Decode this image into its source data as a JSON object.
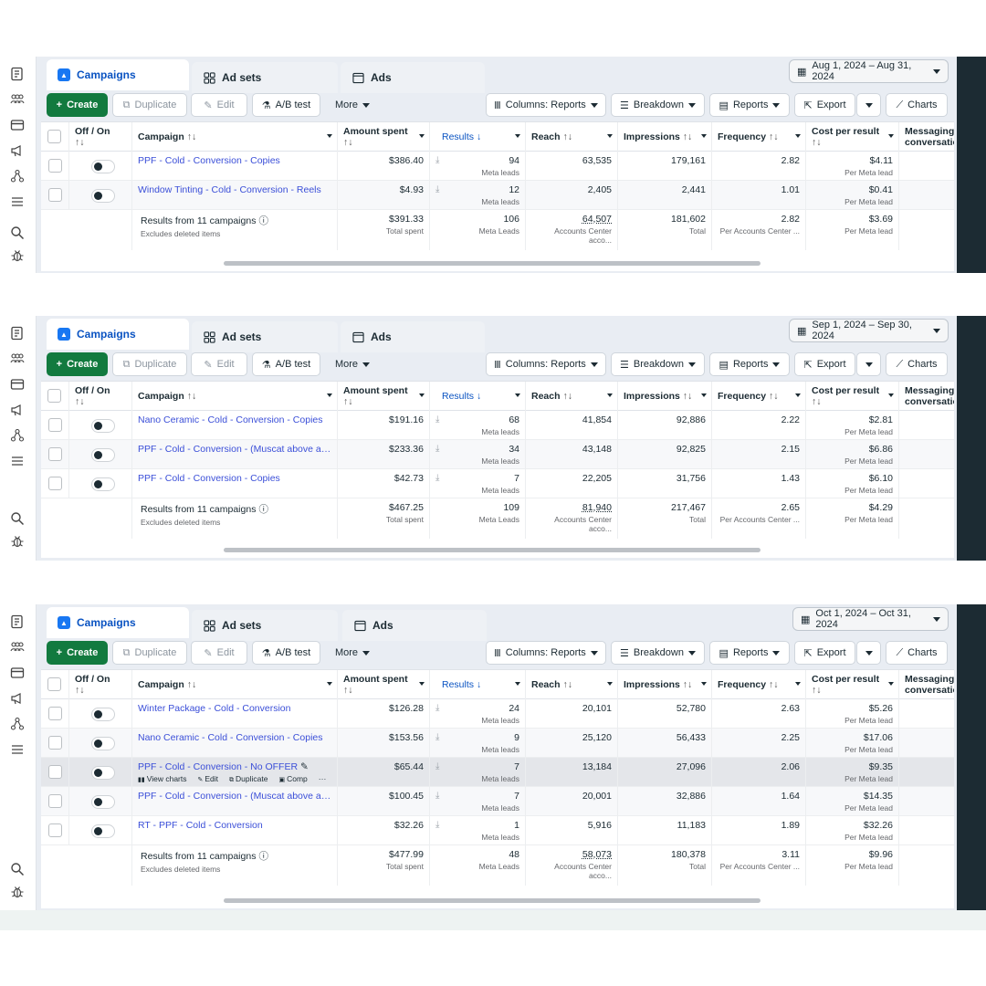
{
  "tabs": {
    "campaigns": "Campaigns",
    "adsets": "Ad sets",
    "ads": "Ads"
  },
  "toolbar": {
    "create": "Create",
    "duplicate": "Duplicate",
    "edit": "Edit",
    "abtest": "A/B test",
    "more": "More",
    "columns": "Columns: Reports",
    "breakdown": "Breakdown",
    "reports": "Reports",
    "export": "Export",
    "charts": "Charts"
  },
  "columns": {
    "offon": "Off / On",
    "campaign": "Campaign",
    "amount": "Amount spent",
    "results": "Results",
    "reach": "Reach",
    "impressions": "Impressions",
    "frequency": "Frequency",
    "cpr": "Cost per result",
    "messaging": "Messaging conversatio",
    "sort_glyph": "↑↓",
    "sort_down": "↓"
  },
  "total_labels": {
    "results_from": "Results from 11 campaigns",
    "excludes": "Excludes deleted items",
    "total_spent": "Total spent",
    "meta_leads_cap": "Meta Leads",
    "accounts_center": "Accounts Center acco...",
    "total": "Total",
    "per_accounts_center": "Per Accounts Center ...",
    "per_meta_lead": "Per Meta lead"
  },
  "sub_labels": {
    "meta_leads": "Meta leads",
    "per_meta_lead": "Per Meta lead"
  },
  "hover_actions": {
    "view_charts": "View charts",
    "edit": "Edit",
    "duplicate": "Duplicate",
    "comp": "Comp",
    "more": "···"
  },
  "panels": [
    {
      "date_range": "Aug 1, 2024 – Aug 31, 2024",
      "rows": [
        {
          "campaign": "PPF - Cold - Conversion - Copies",
          "amount": "$386.40",
          "results": "94",
          "reach": "63,535",
          "impressions": "179,161",
          "frequency": "2.82",
          "cpr": "$4.11"
        },
        {
          "campaign": "Window Tinting - Cold - Conversion - Reels",
          "amount": "$4.93",
          "results": "12",
          "reach": "2,405",
          "impressions": "2,441",
          "frequency": "1.01",
          "cpr": "$0.41"
        }
      ],
      "totals": {
        "amount": "$391.33",
        "results": "106",
        "reach": "64,507",
        "impressions": "181,602",
        "frequency": "2.82",
        "cpr": "$3.69"
      }
    },
    {
      "date_range": "Sep 1, 2024 – Sep 30, 2024",
      "rows": [
        {
          "campaign": "Nano Ceramic - Cold - Conversion - Copies",
          "amount": "$191.16",
          "results": "68",
          "reach": "41,854",
          "impressions": "92,886",
          "frequency": "2.22",
          "cpr": "$2.81"
        },
        {
          "campaign": "PPF - Cold - Conversion - (Muscat above airp...",
          "amount": "$233.36",
          "results": "34",
          "reach": "43,148",
          "impressions": "92,825",
          "frequency": "2.15",
          "cpr": "$6.86"
        },
        {
          "campaign": "PPF - Cold - Conversion - Copies",
          "amount": "$42.73",
          "results": "7",
          "reach": "22,205",
          "impressions": "31,756",
          "frequency": "1.43",
          "cpr": "$6.10"
        }
      ],
      "totals": {
        "amount": "$467.25",
        "results": "109",
        "reach": "81,940",
        "impressions": "217,467",
        "frequency": "2.65",
        "cpr": "$4.29"
      }
    },
    {
      "date_range": "Oct 1, 2024 – Oct 31, 2024",
      "rows": [
        {
          "campaign": "Winter Package - Cold - Conversion",
          "amount": "$126.28",
          "results": "24",
          "reach": "20,101",
          "impressions": "52,780",
          "frequency": "2.63",
          "cpr": "$5.26"
        },
        {
          "campaign": "Nano Ceramic - Cold - Conversion - Copies",
          "amount": "$153.56",
          "results": "9",
          "reach": "25,120",
          "impressions": "56,433",
          "frequency": "2.25",
          "cpr": "$17.06"
        },
        {
          "campaign": "PPF - Cold - Conversion - No OFFER",
          "amount": "$65.44",
          "results": "7",
          "reach": "13,184",
          "impressions": "27,096",
          "frequency": "2.06",
          "cpr": "$9.35"
        },
        {
          "campaign": "PPF - Cold - Conversion - (Muscat above airp...",
          "amount": "$100.45",
          "results": "7",
          "reach": "20,001",
          "impressions": "32,886",
          "frequency": "1.64",
          "cpr": "$14.35"
        },
        {
          "campaign": "RT - PPF - Cold - Conversion",
          "amount": "$32.26",
          "results": "1",
          "reach": "5,916",
          "impressions": "11,183",
          "frequency": "1.89",
          "cpr": "$32.26"
        }
      ],
      "totals": {
        "amount": "$477.99",
        "results": "48",
        "reach": "58,073",
        "impressions": "180,378",
        "frequency": "3.11",
        "cpr": "$9.96"
      }
    }
  ]
}
